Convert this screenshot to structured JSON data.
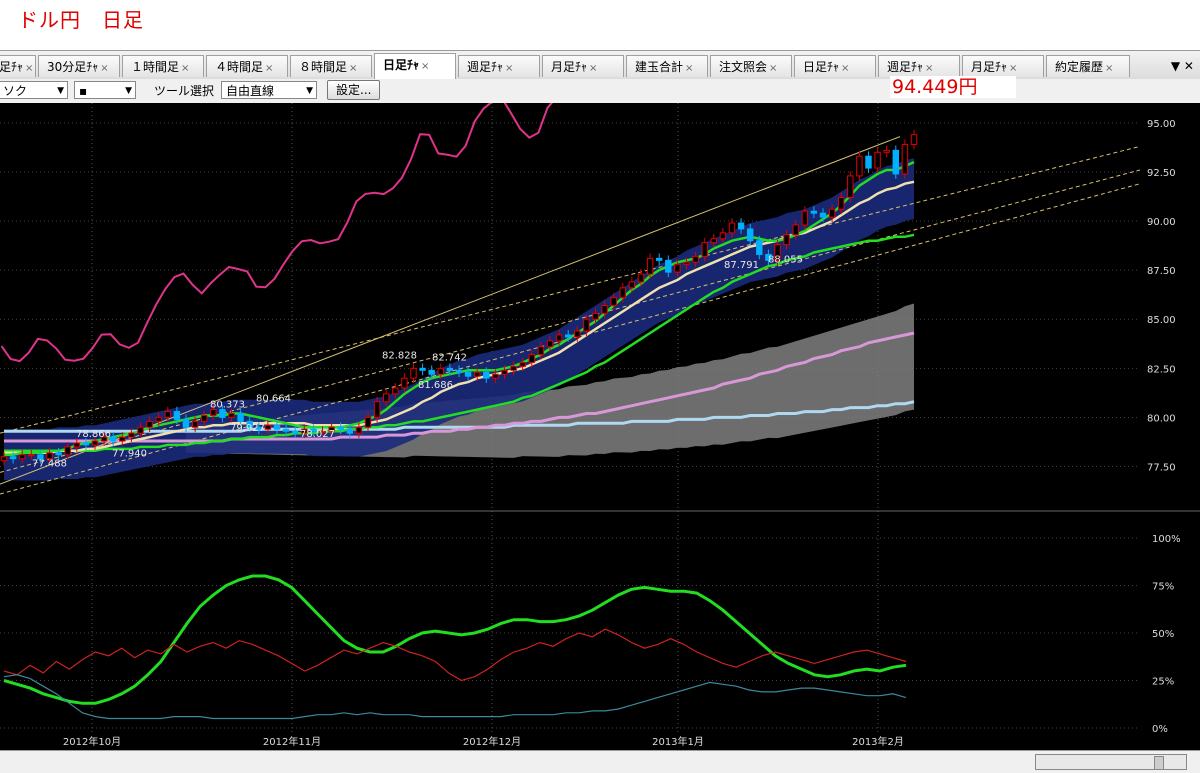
{
  "header": {
    "title": "ドル円　日足"
  },
  "tabs": [
    {
      "label": "足ﾁｬ",
      "active": false
    },
    {
      "label": "30分足ﾁｬ",
      "active": false
    },
    {
      "label": "１時間足",
      "active": false
    },
    {
      "label": "４時間足",
      "active": false
    },
    {
      "label": "８時間足",
      "active": false
    },
    {
      "label": "日足ﾁｬ",
      "active": true
    },
    {
      "label": "週足ﾁｬ",
      "active": false
    },
    {
      "label": "月足ﾁｬ",
      "active": false
    },
    {
      "label": "建玉合計",
      "active": false
    },
    {
      "label": "注文照会",
      "active": false
    },
    {
      "label": "日足ﾁｬ",
      "active": false
    },
    {
      "label": "週足ﾁｬ",
      "active": false
    },
    {
      "label": "月足ﾁｬ",
      "active": false
    },
    {
      "label": "約定履歴",
      "active": false
    }
  ],
  "tab_close": "×",
  "toolbar": {
    "chart_type_value": "ソク",
    "marker_value": "▪",
    "tool_label": "ツール選択",
    "tool_value": "自由直線",
    "settings_label": "設定..."
  },
  "price_display": "94.449円",
  "colors": {
    "background": "#000000",
    "up_candle": "#e00000",
    "down_candle": "#00b0ff",
    "rsi_pink": "#e0338a",
    "ma_green": "#22dd22",
    "ma_cream": "#f0e0b0",
    "ma_violet": "#d898d8",
    "ma_lightblue": "#b0d8f0",
    "ichimoku_cloud": "#808080",
    "bollinger_band": "#1a2a7a",
    "trendline": "#d4c070"
  },
  "chart_data": {
    "type": "candlestick",
    "x_tick_labels": [
      "2012年10月",
      "2012年11月",
      "2012年12月",
      "2013年1月",
      "2013年2月"
    ],
    "main_panel": {
      "y_axis_labels": [
        "95.00",
        "92.50",
        "90.00",
        "87.50",
        "85.00",
        "82.50",
        "80.00",
        "77.50"
      ],
      "ylim": [
        76.0,
        95.4
      ],
      "price_annotations": [
        "77.488",
        "77.940",
        "78.866",
        "79.927",
        "80.373",
        "80.664",
        "78.027",
        "82.828",
        "82.742",
        "81.686",
        "87.791",
        "88.055"
      ],
      "closes": [
        78.0,
        77.9,
        78.1,
        78.1,
        77.9,
        78.2,
        78.1,
        78.5,
        78.7,
        78.6,
        78.8,
        79.0,
        78.8,
        79.0,
        79.2,
        79.5,
        79.8,
        80.0,
        80.3,
        79.9,
        79.5,
        79.8,
        80.1,
        80.4,
        80.0,
        80.2,
        79.8,
        79.5,
        79.4,
        79.6,
        79.4,
        79.3,
        79.2,
        79.4,
        79.3,
        79.3,
        79.5,
        79.4,
        79.2,
        79.5,
        80.0,
        80.8,
        81.2,
        81.5,
        82.0,
        82.5,
        82.4,
        82.2,
        82.5,
        82.4,
        82.3,
        82.1,
        82.3,
        82.0,
        82.2,
        82.4,
        82.6,
        82.8,
        83.2,
        83.6,
        83.9,
        84.2,
        84.1,
        84.4,
        85.0,
        85.3,
        85.7,
        86.1,
        86.6,
        86.9,
        87.3,
        88.1,
        88.0,
        87.4,
        87.8,
        87.9,
        88.2,
        88.9,
        89.1,
        89.4,
        89.9,
        89.6,
        89.0,
        88.3,
        88.0,
        88.8,
        89.3,
        89.8,
        90.5,
        90.4,
        90.2,
        90.6,
        91.2,
        92.3,
        93.3,
        92.7,
        93.5,
        93.6,
        92.4,
        93.9,
        94.4
      ],
      "indicator_lines": [
        {
          "kind": "ma_short",
          "values": [
            78.1,
            78.1,
            78.2,
            78.2,
            78.2,
            78.3,
            78.3,
            78.4,
            78.6,
            78.7,
            78.8,
            78.9,
            79.0,
            79.1,
            79.2,
            79.3,
            79.5,
            79.6,
            79.7,
            79.8,
            79.9,
            80.0,
            80.1,
            80.1,
            80.1,
            80.2,
            80.2,
            80.1,
            80.0,
            79.9,
            79.8,
            79.7,
            79.6,
            79.5,
            79.5,
            79.5,
            79.5,
            79.5,
            79.6,
            79.7,
            79.9,
            80.1,
            80.4,
            80.8,
            81.2,
            81.5,
            81.8,
            82.0,
            82.1,
            82.2,
            82.3,
            82.4,
            82.4,
            82.4,
            82.4,
            82.5,
            82.6,
            82.8,
            83.0,
            83.2,
            83.5,
            83.7,
            84.0,
            84.3,
            84.6,
            84.9,
            85.3,
            85.7,
            86.1,
            86.5,
            86.8,
            87.2,
            87.5,
            87.7,
            87.9,
            88.0,
            88.1,
            88.3,
            88.6,
            88.8,
            89.0,
            89.1,
            89.2,
            89.1,
            89.0,
            89.0,
            89.1,
            89.3,
            89.5,
            89.8,
            90.1,
            90.4,
            90.8,
            91.3,
            91.8,
            92.1,
            92.4,
            92.6,
            92.6,
            92.8,
            93.0
          ]
        },
        {
          "kind": "ma_mid",
          "values": [
            78.2,
            78.2,
            78.2,
            78.2,
            78.2,
            78.2,
            78.3,
            78.3,
            78.3,
            78.4,
            78.4,
            78.5,
            78.6,
            78.7,
            78.8,
            78.9,
            79.0,
            79.1,
            79.2,
            79.3,
            79.4,
            79.5,
            79.5,
            79.6,
            79.6,
            79.7,
            79.7,
            79.7,
            79.7,
            79.7,
            79.7,
            79.7,
            79.7,
            79.7,
            79.6,
            79.6,
            79.6,
            79.6,
            79.6,
            79.6,
            79.7,
            79.8,
            79.9,
            80.1,
            80.3,
            80.5,
            80.8,
            81.0,
            81.3,
            81.5,
            81.7,
            81.8,
            82.0,
            82.1,
            82.2,
            82.3,
            82.4,
            82.5,
            82.7,
            82.9,
            83.1,
            83.3,
            83.6,
            83.9,
            84.2,
            84.5,
            84.8,
            85.1,
            85.4,
            85.7,
            86.0,
            86.3,
            86.6,
            86.8,
            87.0,
            87.3,
            87.5,
            87.7,
            87.9,
            88.1,
            88.3,
            88.5,
            88.7,
            88.8,
            88.9,
            89.0,
            89.2,
            89.3,
            89.4,
            89.6,
            89.8,
            90.0,
            90.3,
            90.6,
            90.9,
            91.1,
            91.4,
            91.6,
            91.7,
            91.9,
            92.0
          ]
        },
        {
          "kind": "ma_long",
          "values": [
            78.3,
            78.3,
            78.3,
            78.3,
            78.3,
            78.3,
            78.3,
            78.3,
            78.3,
            78.3,
            78.3,
            78.4,
            78.4,
            78.4,
            78.4,
            78.5,
            78.5,
            78.5,
            78.6,
            78.6,
            78.6,
            78.7,
            78.7,
            78.8,
            78.8,
            78.9,
            78.9,
            79.0,
            79.0,
            79.0,
            79.1,
            79.1,
            79.2,
            79.2,
            79.2,
            79.3,
            79.3,
            79.3,
            79.4,
            79.4,
            79.5,
            79.5,
            79.6,
            79.6,
            79.7,
            79.8,
            79.8,
            79.9,
            80.0,
            80.1,
            80.2,
            80.3,
            80.4,
            80.5,
            80.6,
            80.7,
            80.8,
            81.0,
            81.1,
            81.3,
            81.5,
            81.7,
            81.9,
            82.1,
            82.3,
            82.6,
            82.8,
            83.1,
            83.4,
            83.7,
            84.0,
            84.3,
            84.6,
            84.9,
            85.2,
            85.5,
            85.8,
            86.1,
            86.4,
            86.6,
            86.9,
            87.1,
            87.3,
            87.5,
            87.7,
            87.8,
            88.0,
            88.1,
            88.2,
            88.4,
            88.5,
            88.6,
            88.7,
            88.8,
            88.9,
            89.0,
            89.0,
            89.1,
            89.2,
            89.2,
            89.3
          ]
        },
        {
          "kind": "ma_200",
          "values": [
            78.8,
            78.8,
            78.8,
            78.8,
            78.8,
            78.8,
            78.8,
            78.8,
            78.8,
            78.8,
            78.8,
            78.8,
            78.8,
            78.8,
            78.8,
            78.8,
            78.8,
            78.8,
            78.8,
            78.8,
            78.8,
            78.8,
            78.8,
            78.8,
            78.8,
            78.9,
            78.9,
            78.9,
            78.9,
            78.9,
            78.9,
            78.9,
            78.9,
            78.9,
            78.9,
            78.9,
            78.9,
            79.0,
            79.0,
            79.0,
            79.0,
            79.0,
            79.1,
            79.1,
            79.1,
            79.2,
            79.2,
            79.3,
            79.3,
            79.3,
            79.4,
            79.4,
            79.5,
            79.5,
            79.6,
            79.6,
            79.7,
            79.7,
            79.8,
            79.8,
            79.9,
            80.0,
            80.0,
            80.1,
            80.2,
            80.2,
            80.3,
            80.4,
            80.5,
            80.6,
            80.7,
            80.8,
            80.9,
            81.0,
            81.1,
            81.2,
            81.3,
            81.4,
            81.5,
            81.7,
            81.8,
            81.9,
            82.0,
            82.2,
            82.3,
            82.4,
            82.6,
            82.7,
            82.8,
            83.0,
            83.1,
            83.2,
            83.4,
            83.5,
            83.6,
            83.8,
            83.9,
            84.0,
            84.1,
            84.2,
            84.3
          ]
        },
        {
          "kind": "ma_flat",
          "values": [
            79.3,
            79.3,
            79.3,
            79.3,
            79.3,
            79.3,
            79.3,
            79.3,
            79.3,
            79.3,
            79.3,
            79.3,
            79.3,
            79.3,
            79.3,
            79.3,
            79.3,
            79.3,
            79.3,
            79.3,
            79.3,
            79.3,
            79.3,
            79.3,
            79.3,
            79.3,
            79.3,
            79.4,
            79.4,
            79.4,
            79.4,
            79.4,
            79.4,
            79.4,
            79.4,
            79.4,
            79.4,
            79.4,
            79.4,
            79.4,
            79.4,
            79.4,
            79.4,
            79.4,
            79.5,
            79.5,
            79.5,
            79.5,
            79.5,
            79.5,
            79.5,
            79.5,
            79.5,
            79.5,
            79.5,
            79.5,
            79.6,
            79.6,
            79.6,
            79.6,
            79.6,
            79.6,
            79.6,
            79.7,
            79.7,
            79.7,
            79.7,
            79.7,
            79.7,
            79.8,
            79.8,
            79.8,
            79.8,
            79.8,
            79.9,
            79.9,
            79.9,
            79.9,
            80.0,
            80.0,
            80.0,
            80.0,
            80.1,
            80.1,
            80.1,
            80.2,
            80.2,
            80.2,
            80.3,
            80.3,
            80.3,
            80.4,
            80.4,
            80.5,
            80.5,
            80.5,
            80.6,
            80.6,
            80.7,
            80.7,
            80.8
          ]
        }
      ]
    },
    "oscillator_panel": {
      "y_axis_labels": [
        "100%",
        "75%",
        "50%",
        "25%",
        "0%"
      ],
      "ylim": [
        0,
        100
      ],
      "series": [
        {
          "kind": "stochastic_green",
          "values": [
            25,
            23,
            21,
            18,
            16,
            14,
            13,
            13,
            15,
            18,
            22,
            28,
            35,
            45,
            55,
            64,
            70,
            75,
            78,
            80,
            80,
            78,
            74,
            67,
            60,
            53,
            46,
            42,
            40,
            40,
            43,
            47,
            50,
            51,
            50,
            49,
            50,
            52,
            55,
            57,
            57,
            56,
            56,
            57,
            59,
            62,
            66,
            70,
            73,
            74,
            73,
            72,
            72,
            71,
            67,
            62,
            56,
            50,
            44,
            38,
            34,
            31,
            28,
            27,
            28,
            30,
            31,
            30,
            32,
            33
          ]
        },
        {
          "kind": "rsi_red",
          "values": [
            30,
            28,
            33,
            29,
            35,
            31,
            36,
            40,
            38,
            42,
            37,
            41,
            39,
            44,
            40,
            43,
            45,
            42,
            46,
            44,
            41,
            38,
            34,
            30,
            33,
            37,
            41,
            39,
            42,
            45,
            43,
            40,
            38,
            35,
            29,
            25,
            27,
            31,
            36,
            40,
            42,
            45,
            43,
            47,
            50,
            48,
            52,
            49,
            45,
            42,
            44,
            47,
            44,
            40,
            37,
            34,
            32,
            35,
            38,
            40,
            38,
            36,
            34,
            36,
            38,
            40,
            41,
            39,
            37,
            35
          ]
        },
        {
          "kind": "volume_teal",
          "values": [
            27,
            28,
            26,
            22,
            18,
            13,
            8,
            6,
            5,
            5,
            5,
            5,
            5,
            6,
            6,
            6,
            5,
            5,
            5,
            5,
            5,
            5,
            5,
            6,
            7,
            7,
            8,
            7,
            8,
            7,
            7,
            7,
            6,
            6,
            6,
            6,
            6,
            6,
            6,
            7,
            7,
            7,
            7,
            8,
            8,
            9,
            9,
            10,
            12,
            14,
            16,
            18,
            20,
            22,
            24,
            23,
            22,
            20,
            19,
            19,
            20,
            21,
            21,
            20,
            19,
            18,
            17,
            17,
            18,
            16
          ]
        }
      ]
    }
  }
}
